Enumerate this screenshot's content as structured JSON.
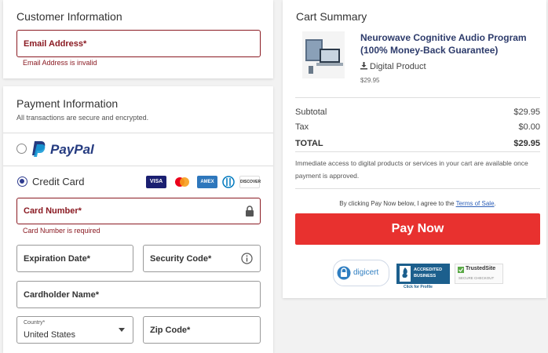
{
  "customer": {
    "title": "Customer Information",
    "email_label": "Email Address*",
    "email_error": "Email Address is invalid"
  },
  "payment": {
    "title": "Payment Information",
    "subtitle": "All transactions are secure and encrypted.",
    "paypal_label": "PayPal",
    "credit_card_label": "Credit Card",
    "card_brands": [
      "VISA",
      "Mastercard",
      "AMEX",
      "Diners",
      "DISCOVER"
    ],
    "card_number_label": "Card Number*",
    "card_number_error": "Card Number is required",
    "expiration_label": "Expiration Date*",
    "security_code_label": "Security Code*",
    "cardholder_label": "Cardholder Name*",
    "country_label": "Country*",
    "country_value": "United States",
    "zip_label": "Zip Code*"
  },
  "cart": {
    "title": "Cart Summary",
    "product_name": "Neurowave Cognitive Audio Program (100% Money-Back Guarantee)",
    "product_type": "Digital Product",
    "product_price": "$29.95",
    "subtotal_label": "Subtotal",
    "subtotal_value": "$29.95",
    "tax_label": "Tax",
    "tax_value": "$0.00",
    "total_label": "TOTAL",
    "total_value": "$29.95",
    "notice": "Immediate access to digital products or services in your cart are available once payment is approved.",
    "terms_prefix": "By clicking Pay Now below, I agree to the",
    "terms_link": "Terms of Sale",
    "terms_suffix": ".",
    "pay_button": "Pay Now"
  },
  "badges": {
    "digicert": "digicert",
    "bbb_line1": "ACCREDITED",
    "bbb_line2": "BUSINESS",
    "bbb_caption": "Click for Profile",
    "trustedsite_title": "TrustedSite",
    "trustedsite_sub": "SECURE CHECKOUT"
  },
  "colors": {
    "error": "#8a1a22",
    "pay_button": "#e8312f",
    "radio": "#2d3b8f",
    "paypal_dark": "#253b80",
    "paypal_light": "#179bd7"
  }
}
